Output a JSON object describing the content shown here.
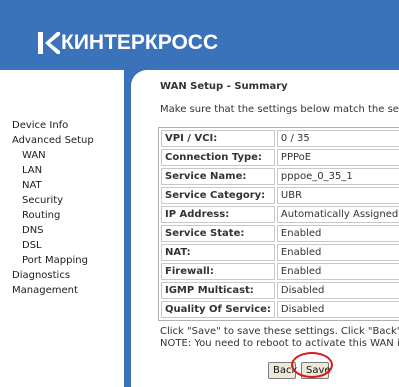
{
  "brand": {
    "name": "КИНТЕРКРОСС"
  },
  "colors": {
    "brand_blue": "#3a73ba",
    "highlight": "#d81b1b"
  },
  "sidebar": {
    "items": [
      {
        "label": "Device Info"
      },
      {
        "label": "Advanced Setup"
      },
      {
        "label": "WAN"
      },
      {
        "label": "LAN"
      },
      {
        "label": "NAT"
      },
      {
        "label": "Security"
      },
      {
        "label": "Routing"
      },
      {
        "label": "DNS"
      },
      {
        "label": "DSL"
      },
      {
        "label": "Port Mapping"
      },
      {
        "label": "Diagnostics"
      },
      {
        "label": "Management"
      }
    ]
  },
  "main": {
    "title": "WAN Setup - Summary",
    "intro": "Make sure that the settings below match the settings pr",
    "summary": [
      {
        "label": "VPI / VCI:",
        "value": "0 / 35"
      },
      {
        "label": "Connection Type:",
        "value": "PPPoE"
      },
      {
        "label": "Service Name:",
        "value": "pppoe_0_35_1"
      },
      {
        "label": "Service Category:",
        "value": "UBR"
      },
      {
        "label": "IP Address:",
        "value": "Automatically Assigned"
      },
      {
        "label": "Service State:",
        "value": "Enabled"
      },
      {
        "label": "NAT:",
        "value": "Enabled"
      },
      {
        "label": "Firewall:",
        "value": "Enabled"
      },
      {
        "label": "IGMP Multicast:",
        "value": "Disabled"
      },
      {
        "label": "Quality Of Service:",
        "value": "Disabled"
      }
    ],
    "note_line1": "Click \"Save\" to save these settings. Click \"Back\" to make",
    "note_line2": "NOTE: You need to reboot to activate this WAN interfac",
    "back_label": "Back",
    "save_label": "Save"
  }
}
